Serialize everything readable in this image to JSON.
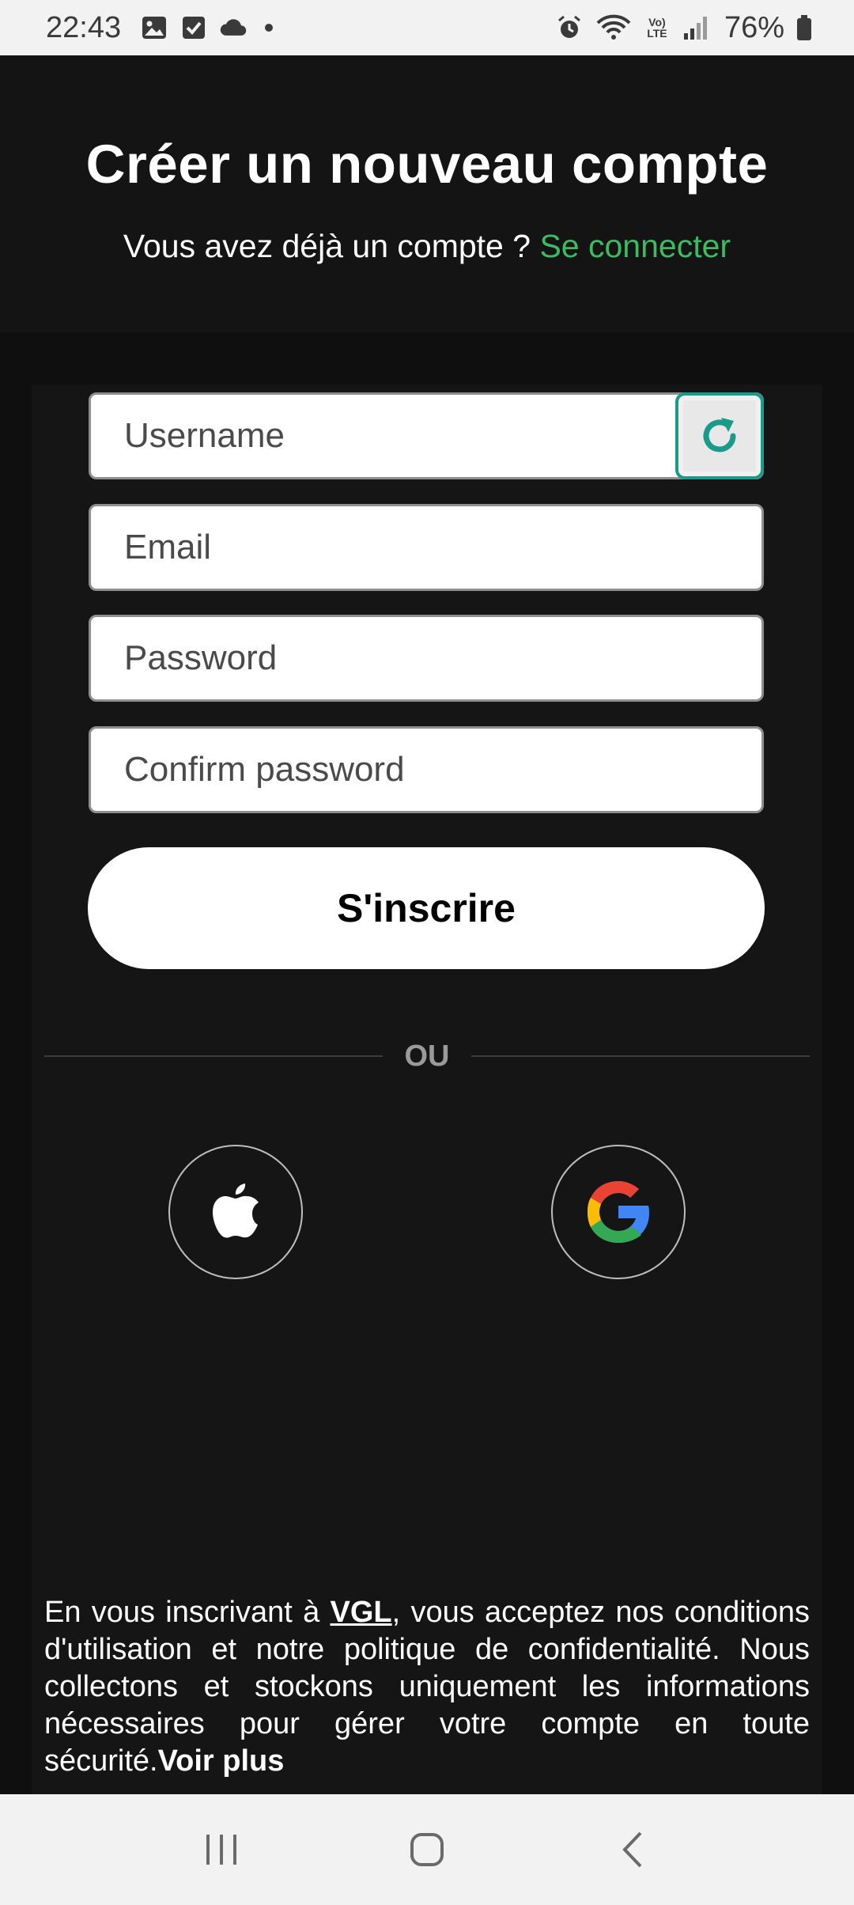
{
  "status_bar": {
    "time": "22:43",
    "battery": "76%",
    "icons": [
      "gallery-icon",
      "checkbox-icon",
      "cloud-icon",
      "dot-icon",
      "alarm-icon",
      "wifi-icon",
      "volte-icon",
      "signal-icon",
      "battery-icon"
    ]
  },
  "header": {
    "title": "Créer un nouveau compte",
    "subtitle_prefix": "Vous avez déjà un compte ?",
    "login_link": "Se connecter",
    "link_color": "#3dbb62"
  },
  "form": {
    "username_placeholder": "Username",
    "email_placeholder": "Email",
    "password_placeholder": "Password",
    "confirm_placeholder": "Confirm password",
    "submit_label": "S'inscrire",
    "refresh_color": "#1a9a8a"
  },
  "divider": {
    "label": "OU"
  },
  "social": {
    "apple": "apple-icon",
    "google": "google-icon"
  },
  "legal": {
    "prefix": "En vous inscrivant à ",
    "brand": "VGL",
    "body": ", vous acceptez nos conditions d'utilisation et notre politique de confidentialité. Nous collectons et stockons uniquement les informations nécessaires pour gérer votre compte en toute sécurité.",
    "more": "Voir plus"
  },
  "nav": {
    "recents": "recents-icon",
    "home": "home-icon",
    "back": "back-icon"
  }
}
